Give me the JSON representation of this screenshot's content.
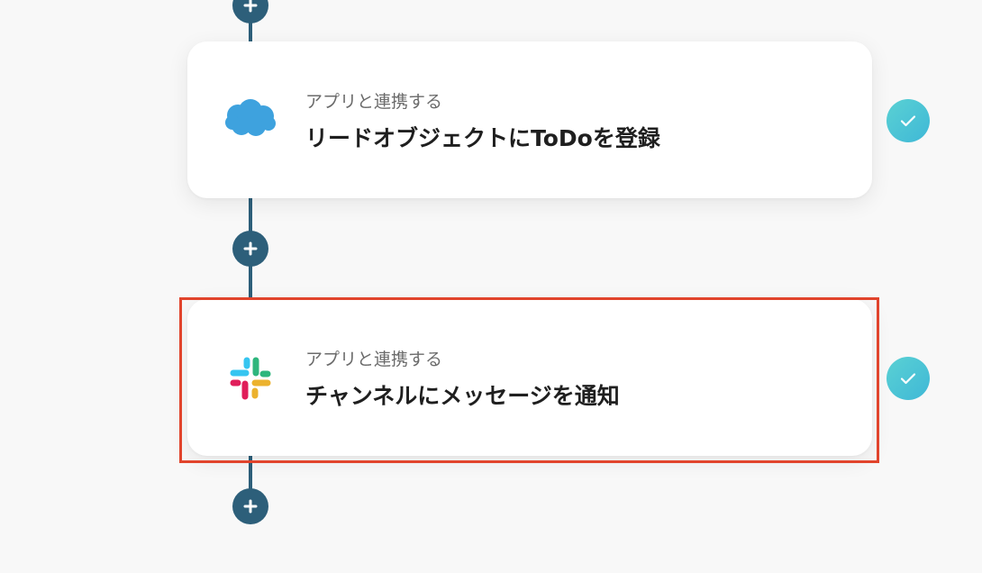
{
  "steps": [
    {
      "app": "Salesforce",
      "subtitle": "アプリと連携する",
      "title": "リードオブジェクトにToDoを登録",
      "status": "complete",
      "icon": "salesforce-cloud-icon"
    },
    {
      "app": "Slack",
      "subtitle": "アプリと連携する",
      "title": "チャンネルにメッセージを通知",
      "status": "complete",
      "icon": "slack-logo-icon",
      "highlighted": true
    }
  ],
  "colors": {
    "background": "#f8f8f8",
    "connector": "#2d5f7a",
    "check": "#4fc6d6",
    "highlight": "#e1442c",
    "salesforce": "#3ea2de"
  }
}
